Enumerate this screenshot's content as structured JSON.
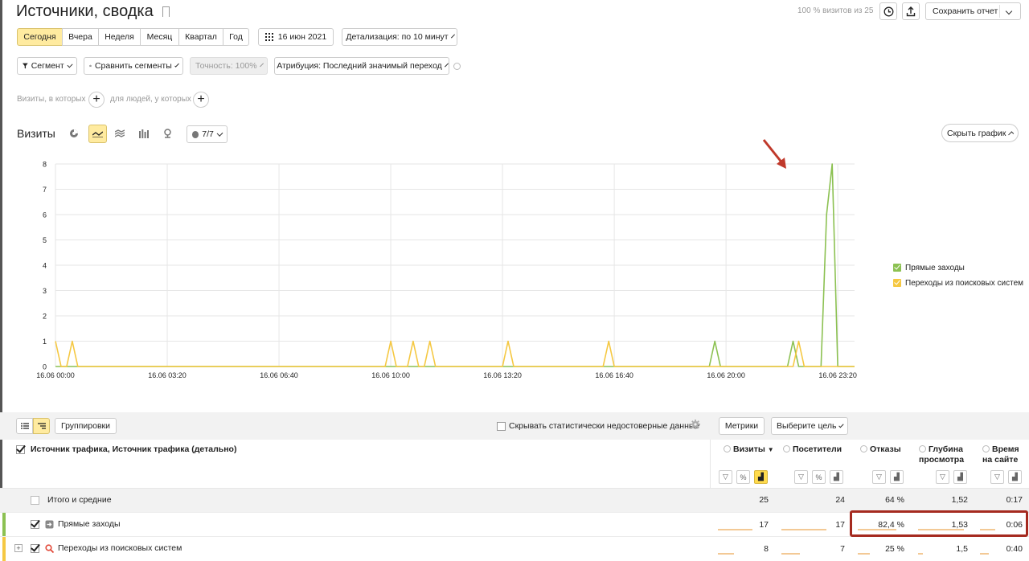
{
  "header": {
    "title": "Источники, сводка",
    "visits_share": "100 % визитов из 25",
    "save_report": "Сохранить отчет"
  },
  "periods": [
    "Сегодня",
    "Вчера",
    "Неделя",
    "Месяц",
    "Квартал",
    "Год"
  ],
  "active_period": "Сегодня",
  "date": "16 июн 2021",
  "detail": "Детализация: по 10 минут",
  "filters": {
    "segment": "Сегмент",
    "compare": "Сравнить сегменты",
    "accuracy": "Точность: 100%",
    "attribution": "Атрибуция: Последний значимый переход"
  },
  "conditions": {
    "visits_where": "Визиты, в которых",
    "people_where": "для людей, у которых"
  },
  "chart_section": {
    "title": "Визиты",
    "series_count": "7/7",
    "hide_chart": "Скрыть график"
  },
  "chart_data": {
    "type": "line",
    "x_tick_labels": [
      "16.06 00:00",
      "16.06 03:20",
      "16.06 06:40",
      "16.06 10:00",
      "16.06 13:20",
      "16.06 16:40",
      "16.06 20:00",
      "16.06 23:20"
    ],
    "x_range_minutes": [
      0,
      1430
    ],
    "ylim": [
      0,
      8
    ],
    "y_ticks": [
      "0",
      "1",
      "2",
      "3",
      "4",
      "5",
      "6",
      "7",
      "8"
    ],
    "grid": true,
    "legend_position": "right",
    "series": [
      {
        "name": "Прямые заходы",
        "color": "#8cc152",
        "points": [
          [
            1170,
            0
          ],
          [
            1180,
            1
          ],
          [
            1190,
            0
          ],
          [
            1310,
            0
          ],
          [
            1320,
            1
          ],
          [
            1330,
            0
          ],
          [
            1370,
            0
          ],
          [
            1380,
            6
          ],
          [
            1390,
            8
          ],
          [
            1400,
            0
          ]
        ]
      },
      {
        "name": "Переходы из поисковых систем",
        "color": "#f5c842",
        "points": [
          [
            0,
            1
          ],
          [
            10,
            0
          ],
          [
            20,
            0
          ],
          [
            30,
            1
          ],
          [
            40,
            0
          ],
          [
            590,
            0
          ],
          [
            600,
            1
          ],
          [
            610,
            0
          ],
          [
            630,
            0
          ],
          [
            640,
            1
          ],
          [
            650,
            0
          ],
          [
            660,
            0
          ],
          [
            670,
            1
          ],
          [
            680,
            0
          ],
          [
            800,
            0
          ],
          [
            810,
            1
          ],
          [
            820,
            0
          ],
          [
            980,
            0
          ],
          [
            990,
            1
          ],
          [
            1000,
            0
          ],
          [
            1320,
            0
          ],
          [
            1330,
            1
          ],
          [
            1340,
            0
          ]
        ]
      }
    ]
  },
  "table_toolbar": {
    "groupings": "Группировки",
    "hide_unreliable": "Скрывать статистически недостоверные данные",
    "metrics": "Метрики",
    "choose_goal": "Выберите цель"
  },
  "table": {
    "dimension_header": "Источник трафика, Источник трафика (детально)",
    "columns": [
      {
        "line1": "Визиты",
        "line2": "",
        "sorted": true
      },
      {
        "line1": "Посетители",
        "line2": ""
      },
      {
        "line1": "Отказы",
        "line2": ""
      },
      {
        "line1": "Глубина",
        "line2": "просмотра"
      },
      {
        "line1": "Время",
        "line2": "на сайте"
      }
    ],
    "totals": {
      "label": "Итого и средние",
      "values": [
        "25",
        "24",
        "64 %",
        "1,52",
        "0:17"
      ]
    },
    "rows": [
      {
        "label": "Прямые заходы",
        "values": [
          "17",
          "17",
          "82,4 %",
          "1,53",
          "0:06"
        ],
        "bars": [
          0.68,
          0.71,
          0.82,
          0.92,
          0.35
        ]
      },
      {
        "label": "Переходы из поисковых систем",
        "values": [
          "8",
          "7",
          "25 %",
          "1,5",
          "0:40"
        ],
        "bars": [
          0.32,
          0.29,
          0.25,
          0.1,
          0.2
        ]
      }
    ]
  }
}
